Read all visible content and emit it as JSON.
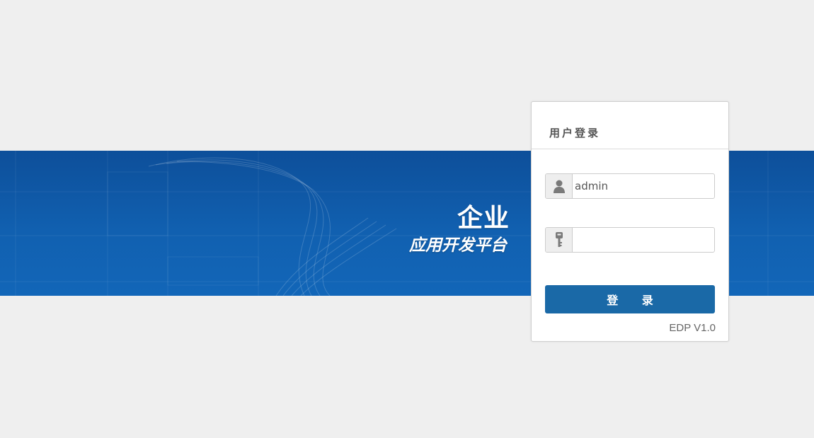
{
  "brand": {
    "title": "企业",
    "subtitle": "应用开发平台"
  },
  "login": {
    "header_title": "用户登录",
    "username_value": "admin",
    "username_placeholder": "",
    "password_value": "",
    "password_placeholder": "",
    "submit_label": "登 录",
    "version": "EDP V1.0"
  },
  "icons": {
    "username": "user-icon",
    "password": "key-icon"
  },
  "colors": {
    "page_background": "#efefef",
    "banner": "#1160b0",
    "button": "#1a69a7"
  }
}
